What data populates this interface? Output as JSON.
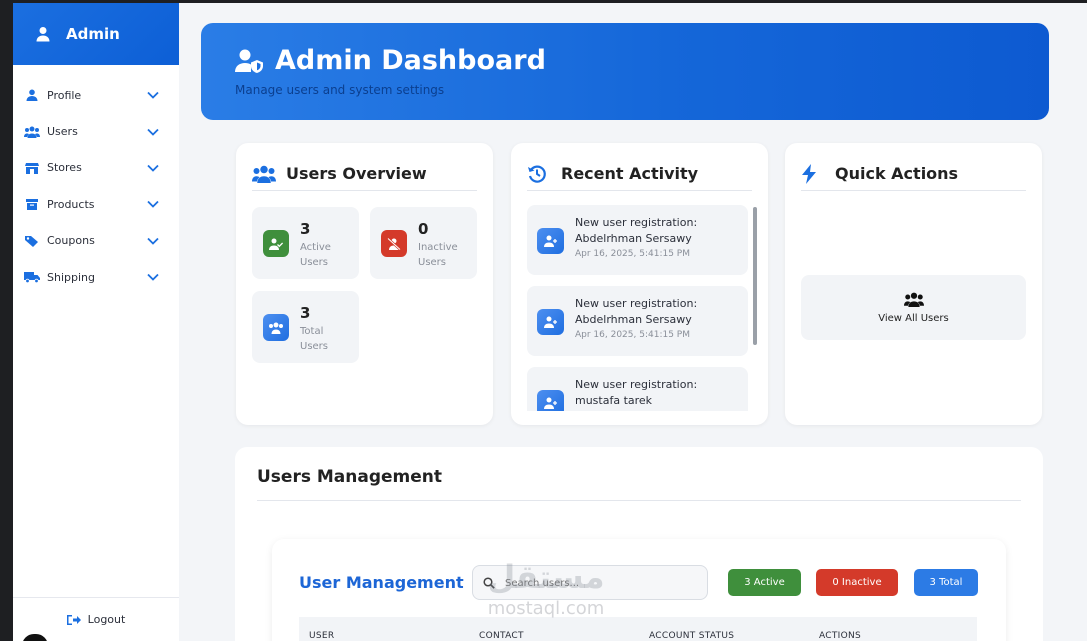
{
  "sidebar": {
    "title": "Admin",
    "items": [
      {
        "label": "Profile",
        "icon": "user-icon"
      },
      {
        "label": "Users",
        "icon": "users-icon"
      },
      {
        "label": "Stores",
        "icon": "store-icon"
      },
      {
        "label": "Products",
        "icon": "box-icon"
      },
      {
        "label": "Coupons",
        "icon": "tag-icon"
      },
      {
        "label": "Shipping",
        "icon": "truck-icon"
      }
    ],
    "logout": "Logout"
  },
  "banner": {
    "title": "Admin Dashboard",
    "subtitle": "Manage users and system settings"
  },
  "overview": {
    "title": "Users Overview",
    "active": {
      "value": "3",
      "label": "Active Users"
    },
    "inactive": {
      "value": "0",
      "label": "Inactive Users"
    },
    "total": {
      "value": "3",
      "label": "Total Users"
    }
  },
  "activity": {
    "title": "Recent Activity",
    "items": [
      {
        "text": "New user registration: Abdelrhman Sersawy",
        "time": "Apr 16, 2025, 5:41:15 PM"
      },
      {
        "text": "New user registration: Abdelrhman Sersawy",
        "time": "Apr 16, 2025, 5:41:15 PM"
      },
      {
        "text": "New user registration: mustafa tarek",
        "time": ""
      }
    ]
  },
  "quick": {
    "title": "Quick Actions",
    "view_all": "View All Users"
  },
  "management": {
    "title": "Users Management",
    "inner_title": "User Management",
    "search_placeholder": "Search users...",
    "pills": {
      "active": "3 Active",
      "inactive": "0 Inactive",
      "total": "3 Total"
    },
    "columns": [
      "USER",
      "CONTACT",
      "ACCOUNT STATUS",
      "ACTIONS"
    ]
  },
  "watermark": {
    "arabic": "مستقل",
    "latin": "mostaql.com"
  },
  "colors": {
    "primary": "#1b6fe0",
    "active": "#3f8f3c",
    "inactive": "#d43a2a",
    "total": "#2c7be5"
  }
}
